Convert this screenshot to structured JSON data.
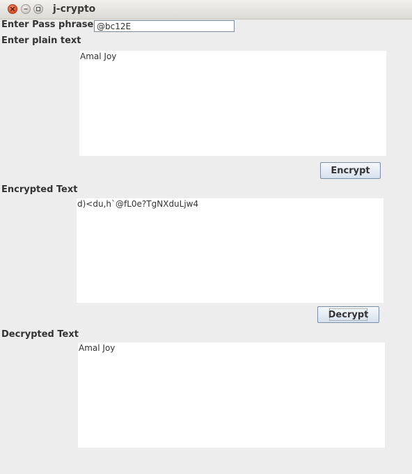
{
  "window": {
    "title": "j-crypto"
  },
  "icons": {
    "close": "close-icon",
    "minimize": "minimize-icon",
    "maximize": "maximize-icon"
  },
  "passphrase": {
    "label": "Enter Pass phrase",
    "value": "@bc12E"
  },
  "plain": {
    "label": "Enter plain text",
    "text": "Amal Joy"
  },
  "encrypt_button": "Encrypt",
  "encrypted": {
    "label": "Encrypted Text",
    "text": "d)<du,h`@fL0e?TgNXduLjw4"
  },
  "decrypt_button": "Decrypt",
  "decrypted": {
    "label": "Decrypted Text",
    "text": "Amal Joy"
  },
  "colors": {
    "close_button": "#dc4f27",
    "background": "#ededed"
  }
}
